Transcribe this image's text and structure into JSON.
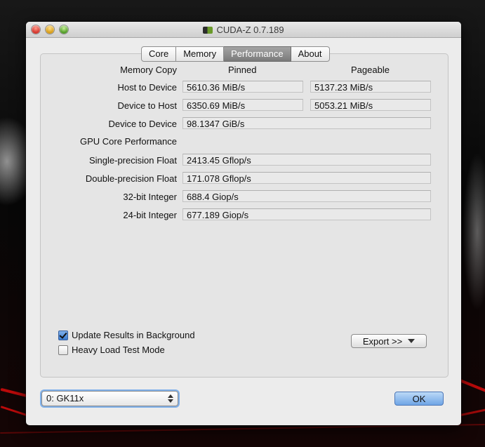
{
  "window": {
    "title": "CUDA-Z 0.7.189"
  },
  "tabs": [
    {
      "label": "Core",
      "active": false
    },
    {
      "label": "Memory",
      "active": false
    },
    {
      "label": "Performance",
      "active": true
    },
    {
      "label": "About",
      "active": false
    }
  ],
  "performance": {
    "memory_copy": {
      "section_label": "Memory Copy",
      "pinned_header": "Pinned",
      "pageable_header": "Pageable",
      "rows": [
        {
          "label": "Host to Device",
          "pinned": "5610.36 MiB/s",
          "pageable": "5137.23 MiB/s"
        },
        {
          "label": "Device to Host",
          "pinned": "6350.69 MiB/s",
          "pageable": "5053.21 MiB/s"
        },
        {
          "label": "Device to Device",
          "value": "98.1347 GiB/s"
        }
      ]
    },
    "gpu_core": {
      "section_label": "GPU Core Performance",
      "rows": [
        {
          "label": "Single-precision Float",
          "value": "2413.45 Gflop/s"
        },
        {
          "label": "Double-precision Float",
          "value": "171.078 Gflop/s"
        },
        {
          "label": "32-bit Integer",
          "value": "688.4 Giop/s"
        },
        {
          "label": "24-bit Integer",
          "value": "677.189 Giop/s"
        }
      ]
    }
  },
  "options": {
    "update_background": {
      "label": "Update Results in Background",
      "checked": true
    },
    "heavy_load": {
      "label": "Heavy Load Test Mode",
      "checked": false
    }
  },
  "buttons": {
    "export": "Export >>",
    "ok": "OK"
  },
  "device_select": {
    "selected": "0: GK11x"
  }
}
